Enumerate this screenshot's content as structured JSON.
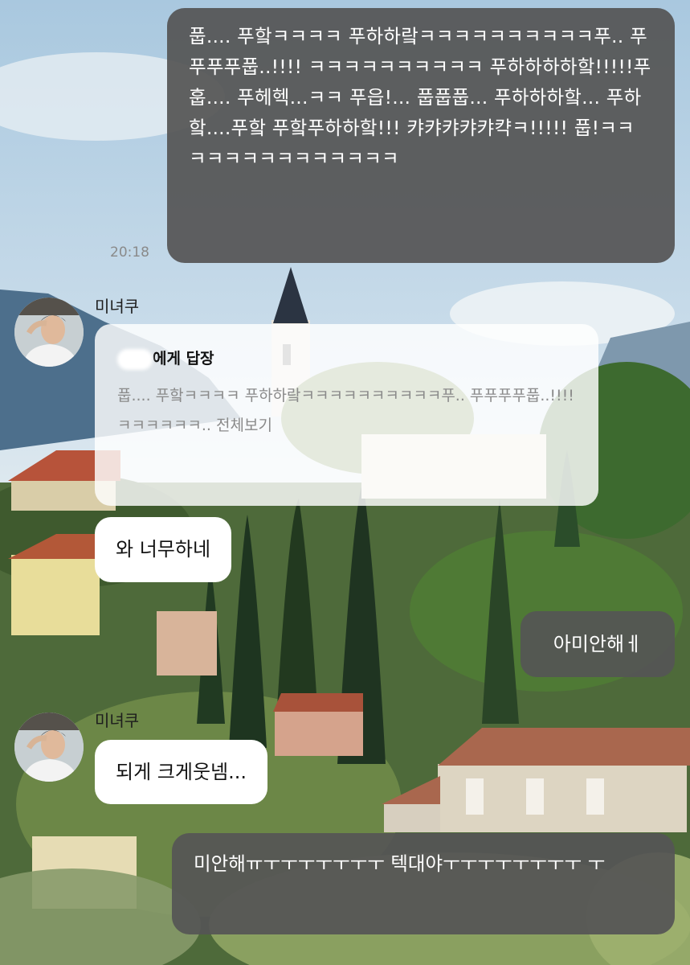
{
  "chat": {
    "messages": [
      {
        "side": "out",
        "text": "풉.... 푸핰ㅋㅋㅋㅋ 푸하하랔ㅋㅋㅋㅋㅋㅋㅋㅋㅋㅋ푸.. 푸푸푸푸풉..!!!! ㅋㅋㅋㅋㅋㅋㅋㅋㅋㅋ 푸하하하하핰!!!!!푸훕.... 푸헤헥...ㅋㅋ 푸읍!... 풉풉풉... 푸하하하핰... 푸하핰....푸핰 푸핰푸하하핰!!! 캬캬캬캬캬캭ㅋ!!!!! 풉!ㅋㅋ ㅋㅋㅋㅋㅋㅋㅋㅋㅋㅋㅋㅋ"
      },
      {
        "side": "out-time",
        "time": "20:18"
      },
      {
        "side": "in",
        "sender": "미녀쿠",
        "reply": {
          "header": "에게 답장",
          "quote": "풉.... 푸핰ㅋㅋㅋㅋ 푸하하랔ㅋㅋㅋㅋㅋㅋㅋㅋㅋㅋ푸.. 푸푸푸푸풉..!!!! ㅋㅋㅋㅋㅋㅋ.. ",
          "more": "전체보기"
        },
        "text": "와 너무하네"
      },
      {
        "side": "out",
        "text": "아미안해ㅔ"
      },
      {
        "side": "in",
        "sender": "미녀쿠",
        "text": "되게 크게웃넴..."
      },
      {
        "side": "out",
        "text": "미안해ㅠㅜㅜㅜㅜㅜㅜㅜ 텍대야ㅜㅜㅜㅜㅜㅜㅜㅜ ㅜ"
      }
    ]
  },
  "colors": {
    "outgoing_bubble": "#555555",
    "incoming_bubble": "#ffffff",
    "time_text": "#8a8a8a"
  }
}
